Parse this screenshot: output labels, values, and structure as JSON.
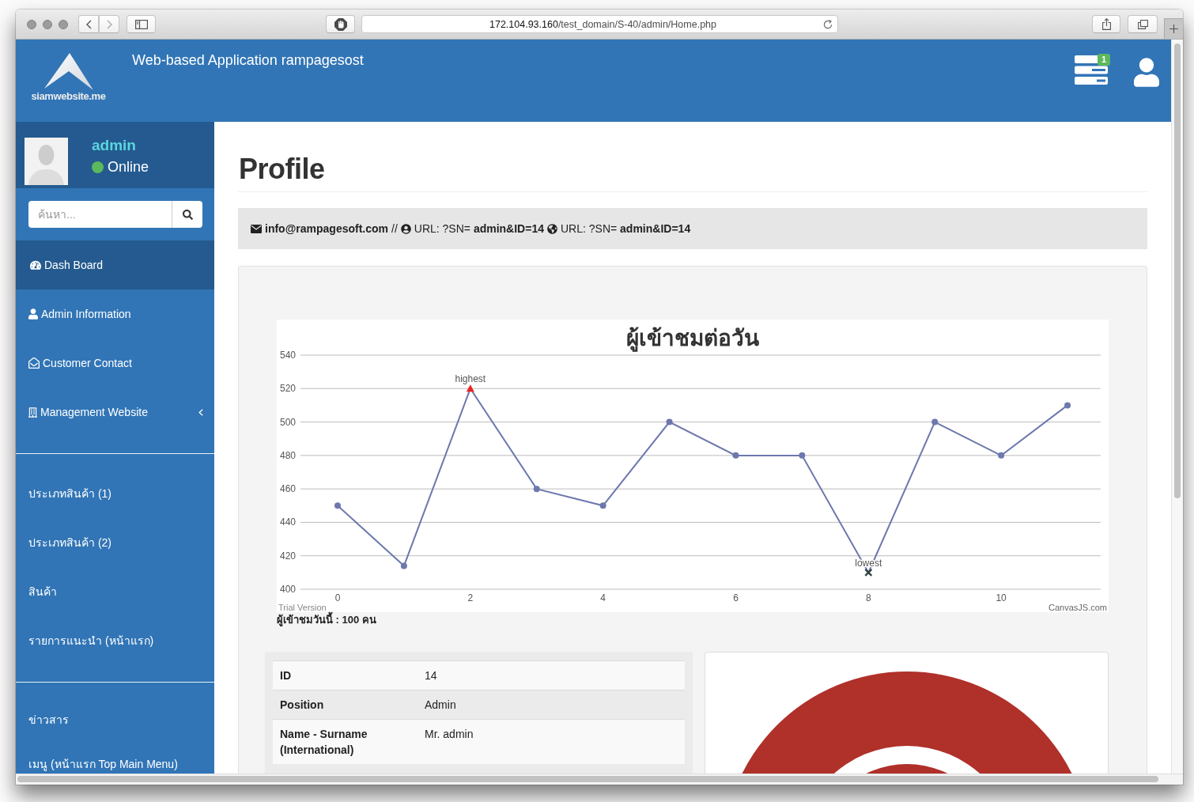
{
  "browser": {
    "url_host": "172.104.93.160",
    "url_path": "/test_domain/S-40/admin/Home.php"
  },
  "header": {
    "logo_text": "siamwebsite.me",
    "title": "Web-based Application rampagesost",
    "notification_count": "1"
  },
  "user_panel": {
    "name": "admin",
    "status": "Online"
  },
  "search": {
    "placeholder": "ค้นหา..."
  },
  "menu_groups": [
    {
      "items": [
        {
          "label": "Dash Board",
          "selected": true,
          "submenu": false
        },
        {
          "label": "Admin Information",
          "selected": false,
          "submenu": false
        },
        {
          "label": "Customer Contact",
          "selected": false,
          "submenu": false
        },
        {
          "label": "Management Website",
          "selected": false,
          "submenu": true
        }
      ]
    },
    {
      "items": [
        {
          "label": "ประเภทสินค้า (1)",
          "selected": false,
          "submenu": false
        },
        {
          "label": "ประเภทสินค้า (2)",
          "selected": false,
          "submenu": false
        },
        {
          "label": "สินค้า",
          "selected": false,
          "submenu": false
        },
        {
          "label": "รายการแนะนำ (หน้าแรก)",
          "selected": false,
          "submenu": false
        }
      ]
    },
    {
      "items": [
        {
          "label": "ข่าวสาร",
          "selected": false,
          "submenu": false
        },
        {
          "label": "เมนู (หน้าแรก Top Main Menu)",
          "selected": false,
          "submenu": false
        }
      ]
    }
  ],
  "page": {
    "title": "Profile"
  },
  "info_bar": {
    "email": "info@rampagesoft.com",
    "separator": "//",
    "items": [
      "URL: ?SN= **admin&ID=14**",
      "URL: ?SN= **admin&ID=14**"
    ]
  },
  "chart": {
    "chart_data": {
      "type": "line",
      "title": "ผู้เข้าชมต่อวัน",
      "x": [
        0,
        1,
        2,
        3,
        4,
        5,
        6,
        7,
        8,
        9,
        10,
        11
      ],
      "series": [
        {
          "color": "#6d78ad",
          "marker": "circle",
          "values": [
            450,
            414,
            520,
            460,
            450,
            500,
            480,
            480,
            410,
            500,
            480,
            510
          ]
        }
      ],
      "xlim": [
        -0.56,
        11.5
      ],
      "ylim": [
        400,
        540
      ],
      "xticks": [
        0,
        2,
        4,
        6,
        8,
        10
      ],
      "yticks": [
        400,
        420,
        440,
        460,
        480,
        500,
        520,
        540
      ],
      "grid": true,
      "annotations": [
        {
          "x": 2,
          "y": 520,
          "text": "highest"
        },
        {
          "x": 8,
          "y": 410,
          "text": "lowest"
        }
      ]
    },
    "trial_label": "Trial Version",
    "credit": "CanvasJS.com"
  },
  "visitors_today": "ผู้เข้าชมวันนี้ : 100 คน",
  "profile_table": {
    "rows": [
      {
        "label": "ID",
        "value": "14"
      },
      {
        "label": "Position",
        "value": "Admin"
      },
      {
        "label": "Name - Surname (International)",
        "value": "Mr. admin"
      }
    ]
  }
}
